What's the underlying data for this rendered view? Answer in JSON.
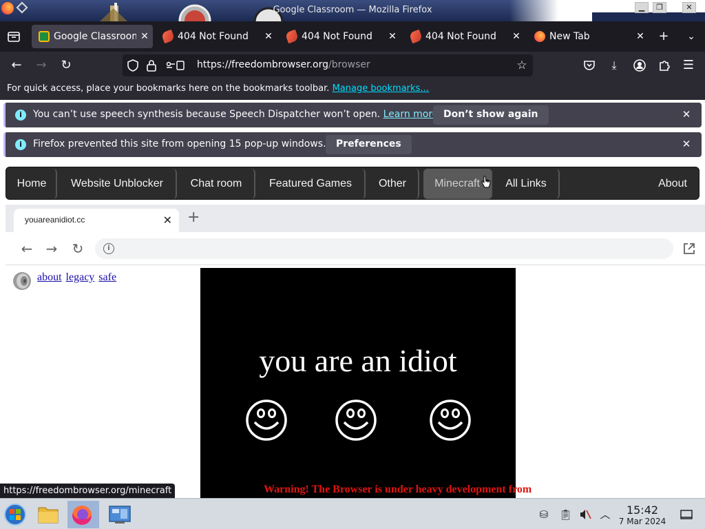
{
  "window": {
    "title": "Google Classroom — Mozilla Firefox"
  },
  "tabs": [
    {
      "label": "Google Classroom",
      "favicon": "google-classroom-icon",
      "active": true
    },
    {
      "label": "404 Not Found",
      "favicon": "freedom-browser-icon"
    },
    {
      "label": "404 Not Found",
      "favicon": "freedom-browser-icon"
    },
    {
      "label": "404 Not Found",
      "favicon": "freedom-browser-icon"
    },
    {
      "label": "New Tab",
      "favicon": "firefox-icon"
    }
  ],
  "urlbar": {
    "host": "https://freedombrowser.org",
    "path": "/browser"
  },
  "bookmarks_bar": {
    "text": "For quick access, place your bookmarks here on the bookmarks toolbar.",
    "link": "Manage bookmarks…"
  },
  "notifications": [
    {
      "message": "You can’t use speech synthesis because Speech Dispatcher won’t open.",
      "link": "Learn more",
      "button": "Don’t show again"
    },
    {
      "message": "Firefox prevented this site from opening 15 pop-up windows.",
      "button": "Preferences"
    }
  ],
  "site_nav": {
    "items": [
      "Home",
      "Website Unblocker",
      "Chat room",
      "Featured Games",
      "Other",
      "Minecraft",
      "All Links",
      "About"
    ],
    "hovered": "Minecraft"
  },
  "embedded_browser": {
    "tab_label": "youareanidiot.cc",
    "links": [
      "about",
      "legacy",
      "safe"
    ],
    "headline": "you are an idiot",
    "warning": "Warning! The Browser is under heavy development from"
  },
  "status_url": "https://freedombrowser.org/minecraft",
  "taskbar": {
    "time": "15:42",
    "date": "7 Mar 2024"
  },
  "colors": {
    "accent_link": "#00ddff",
    "warning_red": "#e0140f",
    "firefox_dark": "#1c1b22"
  }
}
